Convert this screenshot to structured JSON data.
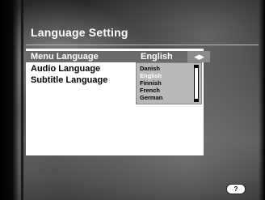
{
  "screen": {
    "title": "Language Setting"
  },
  "menu": {
    "items": [
      {
        "label": "Menu Language",
        "value": "English"
      },
      {
        "label": "Audio Language",
        "value": ""
      },
      {
        "label": "Subtitle Language",
        "value": ""
      }
    ],
    "selected_index": 0,
    "value_arrows": "◀▶"
  },
  "dropdown": {
    "options": [
      "Danish",
      "English",
      "Finnish",
      "French",
      "German"
    ],
    "highlighted": "English"
  },
  "footer": {
    "help_label": "?"
  },
  "colors": {
    "panel_bg": "#ffffff",
    "selection_bg": "#6a6a6a",
    "dropdown_bg": "#b8b8b8",
    "text_primary": "#000000",
    "text_inverse": "#ffffff"
  }
}
